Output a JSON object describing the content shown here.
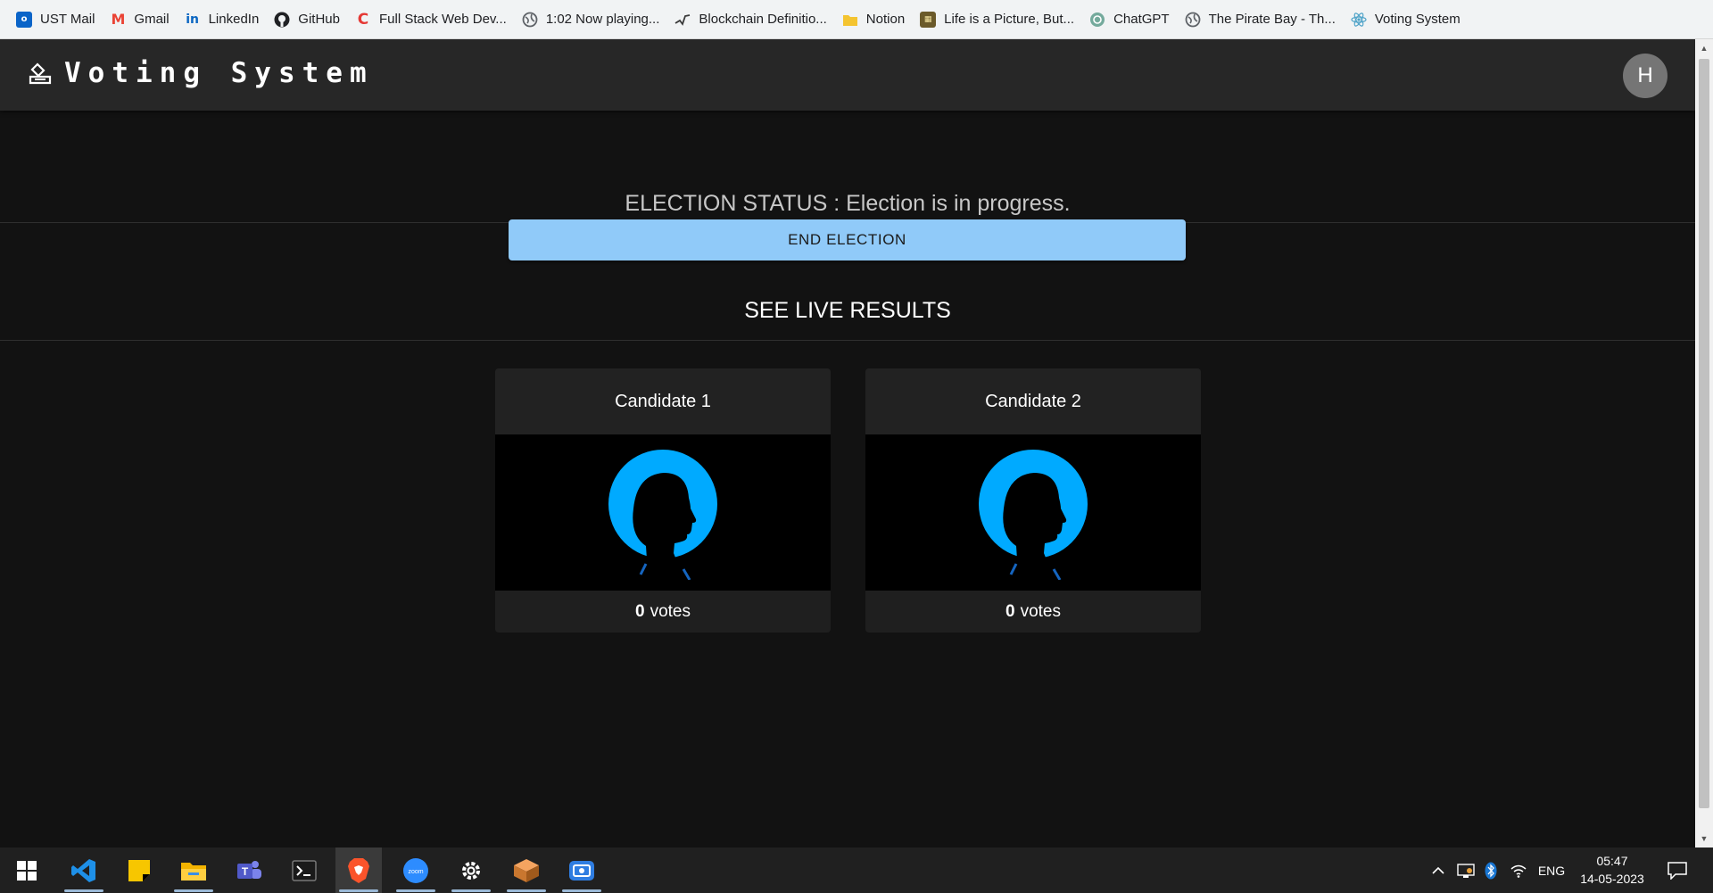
{
  "bookmarks": [
    {
      "label": "UST Mail",
      "icon": "outlook-icon"
    },
    {
      "label": "Gmail",
      "icon": "gmail-icon"
    },
    {
      "label": "LinkedIn",
      "icon": "linkedin-icon"
    },
    {
      "label": "GitHub",
      "icon": "github-icon"
    },
    {
      "label": "Full Stack Web Dev...",
      "icon": "c-logo-icon"
    },
    {
      "label": "1:02 Now playing...",
      "icon": "globe-icon"
    },
    {
      "label": "Blockchain Definitio...",
      "icon": "pulse-icon"
    },
    {
      "label": "Notion",
      "icon": "folder-icon"
    },
    {
      "label": "Life is a Picture, But...",
      "icon": "film-icon"
    },
    {
      "label": "ChatGPT",
      "icon": "chatgpt-icon"
    },
    {
      "label": "The Pirate Bay - Th...",
      "icon": "globe-icon"
    },
    {
      "label": "Voting System",
      "icon": "react-icon"
    }
  ],
  "appbar": {
    "title": "Voting System",
    "avatar_initial": "H"
  },
  "status": {
    "text": "ELECTION STATUS : Election is in progress."
  },
  "end_button": {
    "label": "END ELECTION"
  },
  "results_title": "SEE LIVE RESULTS",
  "candidates": [
    {
      "name": "Candidate 1",
      "votes": "0",
      "votes_label": "votes"
    },
    {
      "name": "Candidate 2",
      "votes": "0",
      "votes_label": "votes"
    }
  ],
  "taskbar": {
    "apps": [
      "windows-start-icon",
      "vscode-icon",
      "sticky-notes-icon",
      "file-explorer-icon",
      "teams-icon",
      "terminal-icon",
      "brave-icon",
      "zoom-icon",
      "settings-icon",
      "box-app-icon",
      "screen-capture-icon"
    ],
    "zoom_label": "zoom",
    "language": "ENG",
    "time": "05:47",
    "date": "14-05-2023"
  },
  "colors": {
    "accent": "#90caf9",
    "avatar_blue": "#00aaff",
    "background": "#121212",
    "appbar": "#272727"
  }
}
